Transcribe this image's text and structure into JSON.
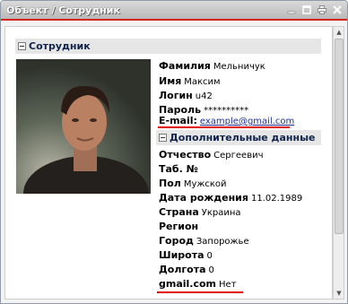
{
  "window": {
    "title": "Объект / Сотрудник"
  },
  "section": {
    "title": "Сотрудник"
  },
  "fields": {
    "surname": {
      "label": "Фамилия",
      "value": "Мельничук"
    },
    "name": {
      "label": "Имя",
      "value": "Максим"
    },
    "login": {
      "label": "Логин",
      "value": "u42"
    },
    "password": {
      "label": "Пароль",
      "value": "**********"
    },
    "email": {
      "label": "E-mail:",
      "value": "example@gmail.com"
    }
  },
  "subsection": {
    "title": "Дополнительные данные"
  },
  "extra": {
    "patronymic": {
      "label": "Отчество",
      "value": "Сергеевич"
    },
    "tab_no": {
      "label": "Таб. №",
      "value": ""
    },
    "gender": {
      "label": "Пол",
      "value": "Мужской"
    },
    "birthdate": {
      "label": "Дата рождения",
      "value": "11.02.1989"
    },
    "country": {
      "label": "Страна",
      "value": "Украина"
    },
    "region": {
      "label": "Регион",
      "value": ""
    },
    "city": {
      "label": "Город",
      "value": "Запорожье"
    },
    "latitude": {
      "label": "Широта",
      "value": "0"
    },
    "longitude": {
      "label": "Долгота",
      "value": "0"
    },
    "gmail": {
      "label": "gmail.com",
      "value": "Нет"
    }
  },
  "colors": {
    "highlight": "#e00000",
    "title_underline": "#d2271f",
    "link": "#1d2f9a"
  },
  "icons": [
    "close-icon",
    "maximize-icon",
    "print-icon",
    "restore-icon",
    "collapse-icon"
  ]
}
